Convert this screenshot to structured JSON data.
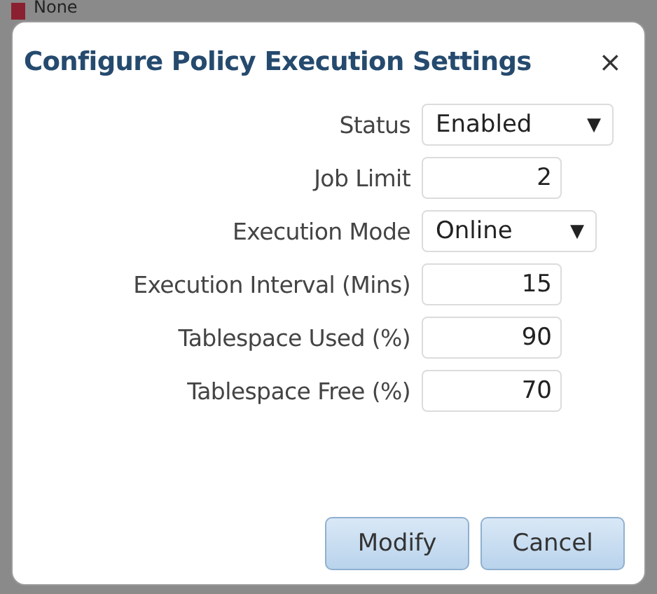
{
  "background": {
    "label": "None"
  },
  "dialog": {
    "title": "Configure Policy Execution Settings",
    "close": "×"
  },
  "fields": [
    {
      "kind": "select",
      "label": "Status",
      "value": "Enabled",
      "caret": "▼"
    },
    {
      "kind": "number",
      "label": "Job Limit",
      "value": "2"
    },
    {
      "kind": "select",
      "label": "Execution Mode",
      "value": "Online",
      "caret": "▼"
    },
    {
      "kind": "number",
      "label": "Execution Interval (Mins)",
      "value": "15"
    },
    {
      "kind": "number",
      "label": "Tablespace Used (%)",
      "value": "90"
    },
    {
      "kind": "number",
      "label": "Tablespace Free (%)",
      "value": "70"
    }
  ],
  "buttons": [
    "Modify",
    "Cancel"
  ]
}
